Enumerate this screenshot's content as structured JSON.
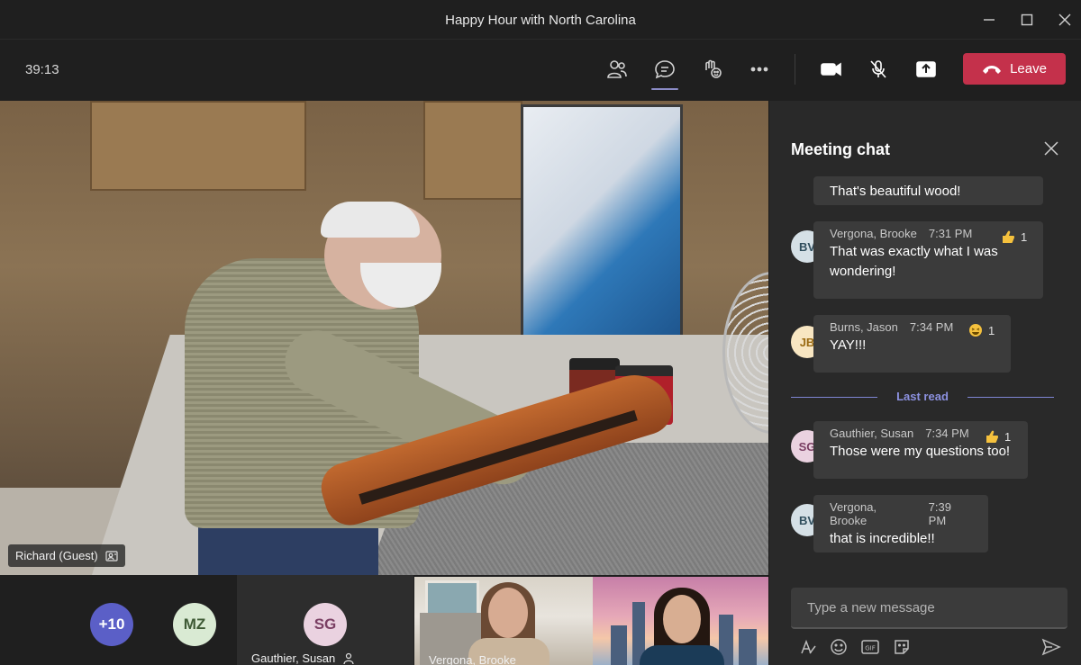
{
  "window": {
    "title": "Happy Hour with North Carolina"
  },
  "toolbar": {
    "timer": "39:13",
    "leave_label": "Leave"
  },
  "video": {
    "presenter_name": "Richard (Guest)"
  },
  "chat": {
    "title": "Meeting chat",
    "messages": [
      {
        "text": "That's beautiful wood!"
      },
      {
        "initials": "BV",
        "author": "Vergona, Brooke",
        "time": "7:31 PM",
        "text": "That was exactly what I was wondering!",
        "reaction": {
          "icon": "thumbs-up",
          "count": "1"
        }
      },
      {
        "initials": "JB",
        "author": "Burns, Jason",
        "time": "7:34 PM",
        "text": "YAY!!!",
        "reaction": {
          "icon": "laughing-face",
          "count": "1"
        }
      },
      {
        "initials": "SG",
        "author": "Gauthier, Susan",
        "time": "7:34 PM",
        "text": "Those were my questions too!",
        "reaction": {
          "icon": "thumbs-up",
          "count": "1"
        }
      },
      {
        "initials": "BV",
        "author": "Vergona, Brooke",
        "time": "7:39 PM",
        "text": "that is incredible!!"
      }
    ],
    "last_read_label": "Last read",
    "compose_placeholder": "Type a new message"
  },
  "participants": {
    "overflow_label": "+10",
    "tiles": [
      {
        "initials": "MZ"
      },
      {
        "initials": "SG",
        "name": "Gauthier, Susan"
      },
      {
        "name": "Vergona, Brooke"
      },
      {
        "name": ""
      }
    ]
  },
  "colors": {
    "leave_red": "#c4314b",
    "accent_purple": "#8b8cc7",
    "last_read": "#8c91e0",
    "overflow_bubble": "#5b5fc7",
    "avatar_bv": "#d5e0e6",
    "avatar_jb": "#f8e6c2",
    "avatar_sg": "#ead2e0",
    "avatar_mz": "#d9ead3"
  }
}
